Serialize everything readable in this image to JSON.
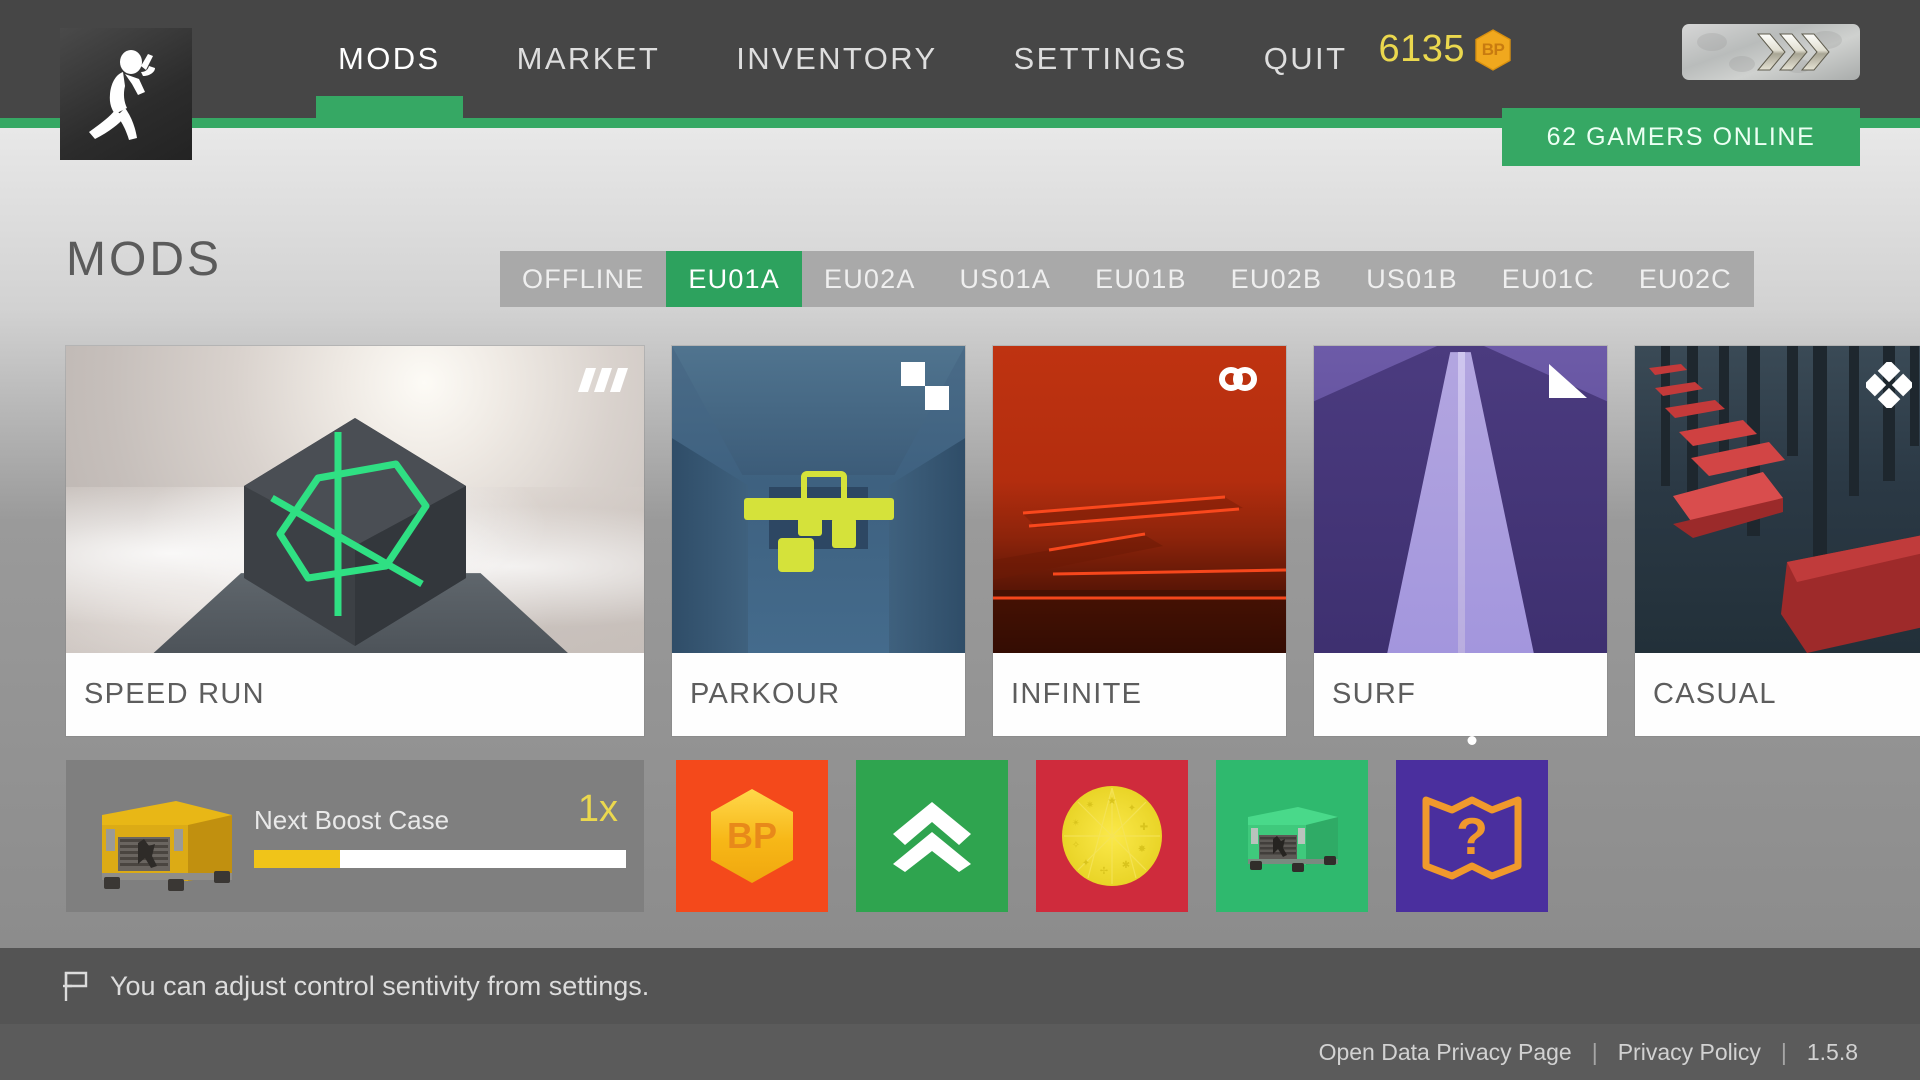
{
  "header": {
    "logo_icon": "running-man-logo",
    "nav": [
      {
        "label": "MODS",
        "active": true
      },
      {
        "label": "MARKET",
        "active": false
      },
      {
        "label": "INVENTORY",
        "active": false
      },
      {
        "label": "SETTINGS",
        "active": false
      },
      {
        "label": "QUIT",
        "active": false
      }
    ],
    "currency": {
      "amount": "6135",
      "icon_label": "BP",
      "color": "#ebd84e"
    },
    "rank_badge_icon": "triple-chevron-rank",
    "online_status": "62 GAMERS ONLINE",
    "accent_color": "#36a864"
  },
  "page": {
    "title": "MODS"
  },
  "servers": {
    "tabs": [
      {
        "label": "OFFLINE",
        "active": false
      },
      {
        "label": "EU01A",
        "active": true
      },
      {
        "label": "EU02A",
        "active": false
      },
      {
        "label": "US01A",
        "active": false
      },
      {
        "label": "EU01B",
        "active": false
      },
      {
        "label": "EU02B",
        "active": false
      },
      {
        "label": "US01B",
        "active": false
      },
      {
        "label": "EU01C",
        "active": false
      },
      {
        "label": "EU02C",
        "active": false
      }
    ]
  },
  "mods": [
    {
      "label": "SPEED RUN",
      "badge_icon": "three-bars-icon",
      "theme": "speed"
    },
    {
      "label": "PARKOUR",
      "badge_icon": "two-squares-icon",
      "theme": "parkour"
    },
    {
      "label": "INFINITE",
      "badge_icon": "infinity-icon",
      "theme": "infinite"
    },
    {
      "label": "SURF",
      "badge_icon": "ramp-triangle-icon",
      "theme": "surf"
    },
    {
      "label": "CASUAL",
      "badge_icon": "diamond-quad-icon",
      "theme": "casual"
    }
  ],
  "boost": {
    "title": "Next Boost Case",
    "multiplier": "1x",
    "progress_percent": 23,
    "crate_icon": "yellow-crate-icon"
  },
  "tiles": [
    {
      "name": "buy-bp-tile",
      "icon": "bp-hexagon-icon",
      "bg": "#f4491b",
      "has_dot": false
    },
    {
      "name": "upgrade-tile",
      "icon": "double-chevron-up-icon",
      "bg": "#2fa44f",
      "has_dot": false
    },
    {
      "name": "wheel-tile",
      "icon": "fortune-wheel-icon",
      "bg": "#cf2b3c",
      "has_dot": false
    },
    {
      "name": "case-tile",
      "icon": "green-crate-icon",
      "bg": "#2fb96e",
      "has_dot": false
    },
    {
      "name": "map-tile",
      "icon": "mystery-map-icon",
      "bg": "#4a2f9e",
      "has_dot": true
    }
  ],
  "tip": {
    "icon": "flag-icon",
    "text": "You can adjust control sentivity from settings."
  },
  "footer": {
    "privacy_page": "Open Data Privacy Page",
    "privacy_policy": "Privacy Policy",
    "version": "1.5.8",
    "separator": "|"
  }
}
